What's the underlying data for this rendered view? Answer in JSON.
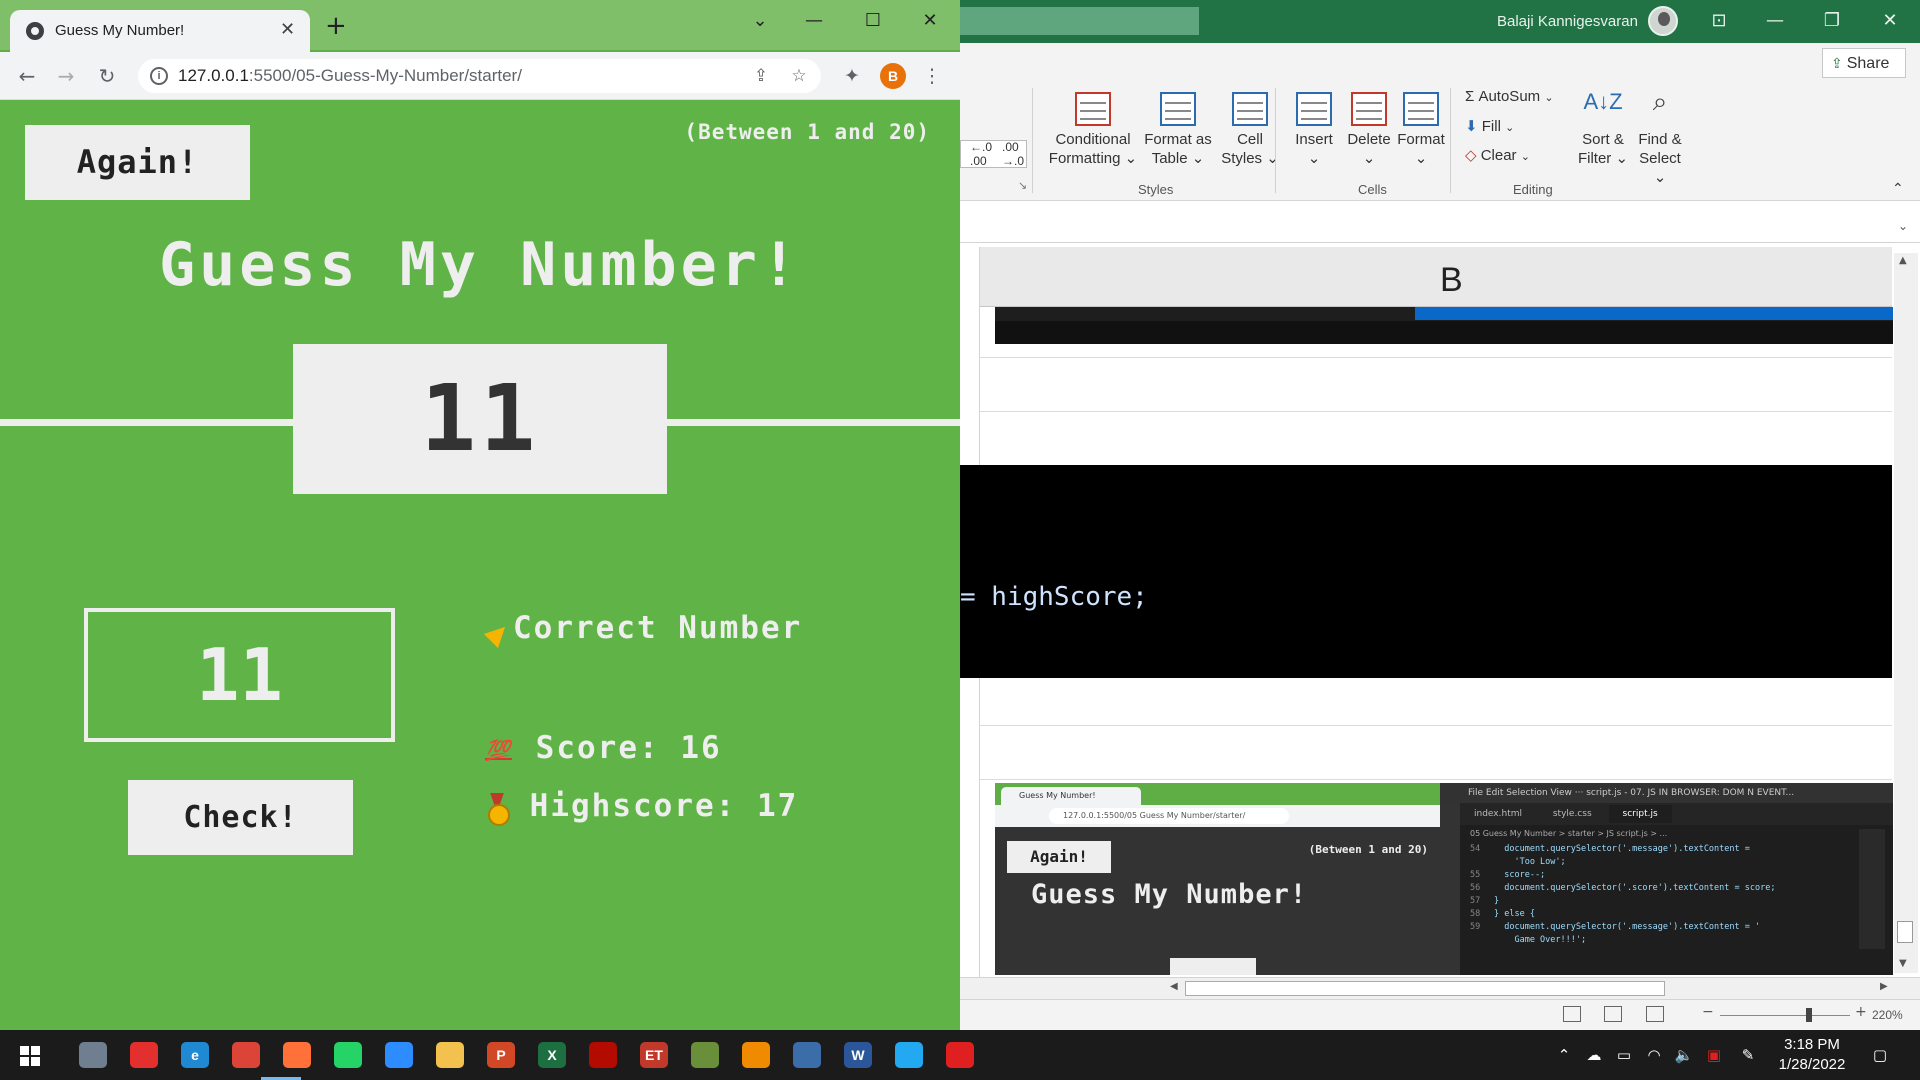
{
  "excel": {
    "user_name": "Balaji Kannigesvaran",
    "share_label": "Share",
    "ribbon": {
      "conditional_formatting": [
        "Conditional",
        "Formatting ⌄"
      ],
      "format_as_table": [
        "Format as",
        "Table ⌄"
      ],
      "cell_styles": [
        "Cell",
        "Styles ⌄"
      ],
      "insert": [
        "Insert",
        "⌄"
      ],
      "delete": [
        "Delete",
        "⌄"
      ],
      "format": [
        "Format",
        "⌄"
      ],
      "autosum": "AutoSum",
      "fill": "Fill",
      "clear": "Clear",
      "sort_filter": [
        "Sort &",
        "Filter ⌄"
      ],
      "find_select": [
        "Find &",
        "Select ⌄"
      ],
      "group_styles": "Styles",
      "group_cells": "Cells",
      "group_editing": "Editing"
    },
    "column_header": "B",
    "code_snippet": "= highScore;",
    "zoom_level": "220%"
  },
  "mini_screenshot": {
    "tab_title": "Guess My Number!",
    "url": "127.0.0.1:5500/05 Guess My Number/starter/",
    "again": "Again!",
    "between": "(Between 1 and 20)",
    "title": "Guess My Number!",
    "menu": "File   Edit   Selection   View   ···   script.js - 07. JS IN BROWSER: DOM N EVENT...",
    "tabs": [
      "index.html",
      "style.css",
      "script.js"
    ],
    "breadcrumb": "05 Guess My Number > starter > JS script.js > ...",
    "code_lines": [
      {
        "ln": "54",
        "text": "  document.querySelector('.message').textContent ="
      },
      {
        "ln": "",
        "text": "    'Too Low';"
      },
      {
        "ln": "55",
        "text": "  score--;"
      },
      {
        "ln": "56",
        "text": "  document.querySelector('.score').textContent = score;"
      },
      {
        "ln": "57",
        "text": "} "
      },
      {
        "ln": "58",
        "text": "} else {"
      },
      {
        "ln": "59",
        "text": "  document.querySelector('.message').textContent = '"
      },
      {
        "ln": "",
        "text": "    Game Over!!!';"
      }
    ]
  },
  "chrome": {
    "tab_title": "Guess My Number!",
    "url_host": "127.0.0.1",
    "url_path": ":5500/05-Guess-My-Number/starter/",
    "profile_initial": "B"
  },
  "game": {
    "again_label": "Again!",
    "range_hint": "(Between 1 and 20)",
    "title": "Guess My Number!",
    "secret_number": "11",
    "guess_value": "11",
    "check_label": "Check!",
    "message": "Correct Number",
    "score_label": "Score:",
    "score_value": "16",
    "highscore_label": "Highscore:",
    "highscore_value": "17"
  },
  "taskbar": {
    "time": "3:18 PM",
    "date": "1/28/2022",
    "apps": [
      {
        "name": "photos",
        "letter": "",
        "color": "#6f7f8f"
      },
      {
        "name": "anydesk",
        "letter": "",
        "color": "#e3302f"
      },
      {
        "name": "edge",
        "letter": "e",
        "color": "#1f8ad2"
      },
      {
        "name": "chrome",
        "letter": "",
        "color": "#db4437"
      },
      {
        "name": "firefox",
        "letter": "",
        "color": "#ff7139"
      },
      {
        "name": "whatsapp",
        "letter": "",
        "color": "#25d366"
      },
      {
        "name": "zoom",
        "letter": "",
        "color": "#2d8cff"
      },
      {
        "name": "file-explorer",
        "letter": "",
        "color": "#f2c14e"
      },
      {
        "name": "powerpoint",
        "letter": "P",
        "color": "#d24726"
      },
      {
        "name": "excel",
        "letter": "X",
        "color": "#1d6f42"
      },
      {
        "name": "acrobat-pro",
        "letter": "",
        "color": "#b30b00"
      },
      {
        "name": "et-app",
        "letter": "ET",
        "color": "#c0392b"
      },
      {
        "name": "tool-app",
        "letter": "",
        "color": "#6a8f3a"
      },
      {
        "name": "vlc",
        "letter": "",
        "color": "#f08a00"
      },
      {
        "name": "remote-desktop",
        "letter": "",
        "color": "#3b6ea8"
      },
      {
        "name": "word",
        "letter": "W",
        "color": "#2b579a"
      },
      {
        "name": "vscode",
        "letter": "",
        "color": "#23a9f2"
      },
      {
        "name": "acrobat-reader",
        "letter": "",
        "color": "#e02020"
      }
    ]
  }
}
